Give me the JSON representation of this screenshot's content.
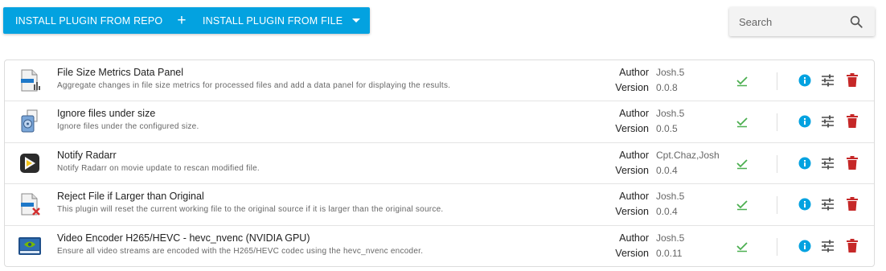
{
  "toolbar": {
    "install_repo_label": "INSTALL PLUGIN FROM REPO",
    "install_repo_icon": "plus-icon",
    "install_file_label": "INSTALL PLUGIN FROM FILE",
    "install_file_icon": "caret-down-icon",
    "accent": "#03a2e0"
  },
  "search": {
    "placeholder": "Search",
    "icon": "search-icon"
  },
  "labels": {
    "author": "Author",
    "version": "Version"
  },
  "plugins": [
    {
      "title": "File Size Metrics Data Panel",
      "description": "Aggregate changes in file size metrics for processed files and add a data panel for displaying the results.",
      "author": "Josh.5",
      "version": "0.0.8",
      "icon": "file-chart-icon"
    },
    {
      "title": "Ignore files under size",
      "description": "Ignore files under the configured size.",
      "author": "Josh.5",
      "version": "0.0.5",
      "icon": "disk-files-icon"
    },
    {
      "title": "Notify Radarr",
      "description": "Notify Radarr on movie update to rescan modified file.",
      "author": "Cpt.Chaz,Josh",
      "version": "0.0.4",
      "icon": "radarr-icon"
    },
    {
      "title": "Reject File if Larger than Original",
      "description": "This plugin will reset the current working file to the original source if it is larger than the original source.",
      "author": "Josh.5",
      "version": "0.0.4",
      "icon": "file-reject-icon"
    },
    {
      "title": "Video Encoder H265/HEVC - hevc_nvenc (NVIDIA GPU)",
      "description": "Ensure all video streams are encoded with the H265/HEVC codec using the hevc_nvenc encoder.",
      "author": "Josh.5",
      "version": "0.0.11",
      "icon": "nvidia-gpu-icon"
    }
  ],
  "colors": {
    "enabled_check": "#4caf50",
    "info": "#03a2e0",
    "delete": "#c62828",
    "settings": "#555555"
  }
}
